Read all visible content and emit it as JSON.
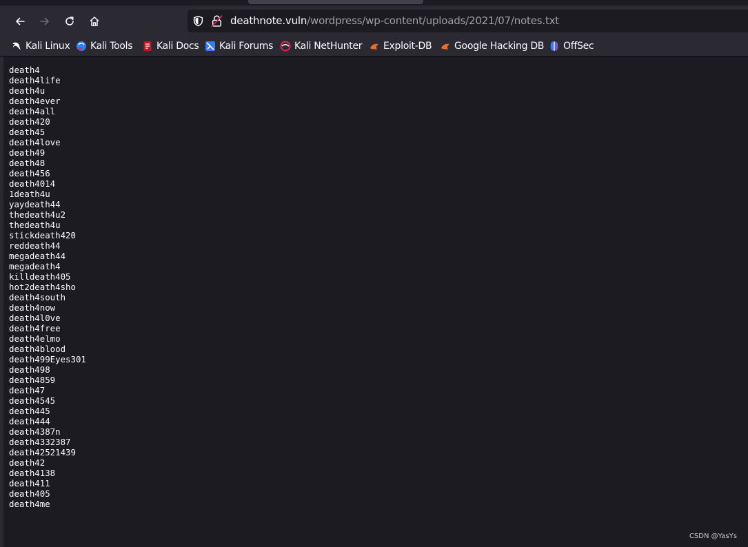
{
  "toolbar": {
    "back_icon": "arrow-left-icon",
    "forward_icon": "arrow-right-icon",
    "reload_icon": "reload-icon",
    "home_icon": "home-icon"
  },
  "urlbar": {
    "host": "deathnote.vuln",
    "path": "/wordpress/wp-content/uploads/2021/07/notes.txt"
  },
  "bookmarks": [
    {
      "label": "Kali Linux",
      "icon": "kali-dragon-icon"
    },
    {
      "label": "Kali Tools",
      "icon": "kali-tools-icon"
    },
    {
      "label": "Kali Docs",
      "icon": "kali-docs-icon"
    },
    {
      "label": "Kali Forums",
      "icon": "kali-forums-icon"
    },
    {
      "label": "Kali NetHunter",
      "icon": "nethunter-icon"
    },
    {
      "label": "Exploit-DB",
      "icon": "exploit-db-icon"
    },
    {
      "label": "Google Hacking DB",
      "icon": "ghdb-icon"
    },
    {
      "label": "OffSec",
      "icon": "offsec-icon"
    }
  ],
  "notes": [
    "death4",
    "death4life",
    "death4u",
    "death4ever",
    "death4all",
    "death420",
    "death45",
    "death4love",
    "death49",
    "death48",
    "death456",
    "death4014",
    "1death4u",
    "yaydeath44",
    "thedeath4u2",
    "thedeath4u",
    "stickdeath420",
    "reddeath44",
    "megadeath44",
    "megadeath4",
    "killdeath405",
    "hot2death4sho",
    "death4south",
    "death4now",
    "death4l0ve",
    "death4free",
    "death4elmo",
    "death4blood",
    "death499Eyes301",
    "death498",
    "death4859",
    "death47",
    "death4545",
    "death445",
    "death444",
    "death4387n",
    "death4332387",
    "death42521439",
    "death42",
    "death4138",
    "death411",
    "death405",
    "death4me"
  ],
  "watermark": "CSDN @YasYs",
  "colors": {
    "toolbar_bg": "#2b2a33",
    "page_bg": "#1c1b22",
    "text": "#fbfbfe",
    "url_path": "#9e9ea4"
  }
}
